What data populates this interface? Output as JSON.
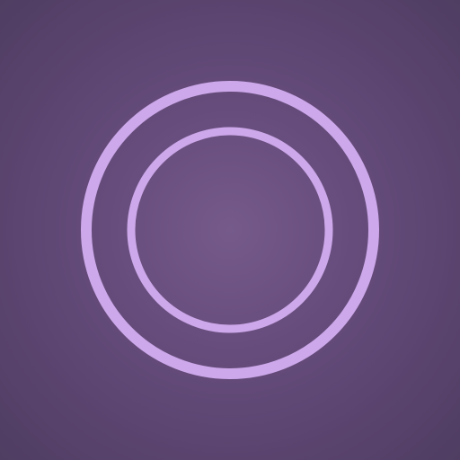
{
  "app": {
    "name": "",
    "screen": "concentric-rings"
  },
  "theme": {
    "background_center": "#755a8a",
    "background_mid": "#664c7c",
    "background_edge": "#4f3d62",
    "ring_color": "#cda8ea"
  },
  "elements": {
    "outer_ring": {
      "icon": "outer-ring-icon"
    },
    "inner_ring": {
      "icon": "inner-ring-icon"
    }
  }
}
